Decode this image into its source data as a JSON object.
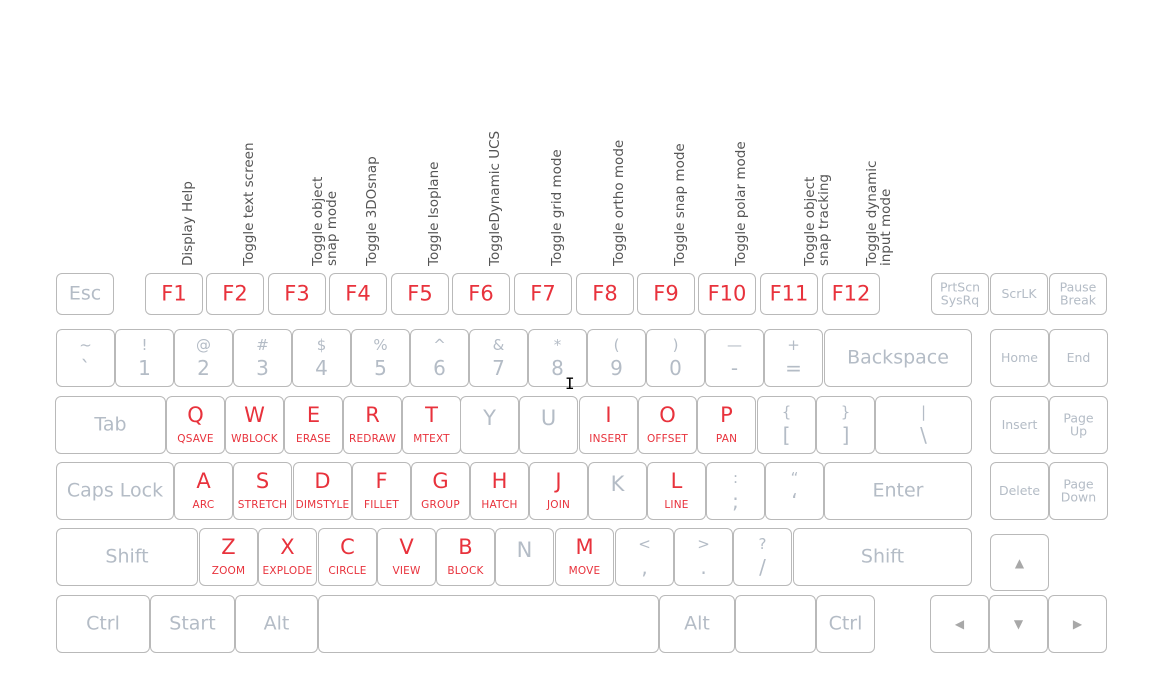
{
  "function_descriptions": [
    {
      "key": "F1",
      "lines": [
        "Display Help"
      ]
    },
    {
      "key": "F2",
      "lines": [
        "Toggle text screen"
      ]
    },
    {
      "key": "F3",
      "lines": [
        "Toggle object",
        "snap mode"
      ]
    },
    {
      "key": "F4",
      "lines": [
        "Toggle 3DOsnap"
      ]
    },
    {
      "key": "F5",
      "lines": [
        "Toggle Isoplane"
      ]
    },
    {
      "key": "F6",
      "lines": [
        "ToggleDynamic UCS"
      ]
    },
    {
      "key": "F7",
      "lines": [
        "Toggle grid mode"
      ]
    },
    {
      "key": "F8",
      "lines": [
        "Toggle ortho mode"
      ]
    },
    {
      "key": "F9",
      "lines": [
        "Toggle snap mode"
      ]
    },
    {
      "key": "F10",
      "lines": [
        "Toggle polar mode"
      ]
    },
    {
      "key": "F11",
      "lines": [
        "Toggle object",
        "snap tracking"
      ]
    },
    {
      "key": "F12",
      "lines": [
        "Toggle dynamic",
        "input mode"
      ]
    }
  ],
  "colors": {
    "accent": "#e8323c",
    "key_text": "#b4bcc6",
    "border": "#b9b9b9",
    "description_text": "#555555"
  },
  "keys": {
    "esc": "Esc",
    "fkeys": [
      "F1",
      "F2",
      "F3",
      "F4",
      "F5",
      "F6",
      "F7",
      "F8",
      "F9",
      "F10",
      "F11",
      "F12"
    ],
    "prtscn": [
      "PrtScn",
      "SysRq"
    ],
    "scrlk": "ScrLK",
    "pause": [
      "Pause",
      "Break"
    ],
    "number_row": [
      {
        "top": "~",
        "bot": "`"
      },
      {
        "top": "!",
        "bot": "1"
      },
      {
        "top": "@",
        "bot": "2"
      },
      {
        "top": "#",
        "bot": "3"
      },
      {
        "top": "$",
        "bot": "4"
      },
      {
        "top": "%",
        "bot": "5"
      },
      {
        "top": "^",
        "bot": "6"
      },
      {
        "top": "&",
        "bot": "7"
      },
      {
        "top": "*",
        "bot": "8"
      },
      {
        "top": "(",
        "bot": "9"
      },
      {
        "top": ")",
        "bot": "0"
      },
      {
        "top": "—",
        "bot": "-"
      },
      {
        "top": "+",
        "bot": "="
      }
    ],
    "backspace": "Backspace",
    "home": "Home",
    "end": "End",
    "tab": "Tab",
    "qwerty_row": [
      {
        "key": "Q",
        "cmd": "QSAVE"
      },
      {
        "key": "W",
        "cmd": "WBLOCK"
      },
      {
        "key": "E",
        "cmd": "ERASE"
      },
      {
        "key": "R",
        "cmd": "REDRAW"
      },
      {
        "key": "T",
        "cmd": "MTEXT"
      },
      {
        "key": "Y",
        "cmd": ""
      },
      {
        "key": "U",
        "cmd": ""
      },
      {
        "key": "I",
        "cmd": "INSERT"
      },
      {
        "key": "O",
        "cmd": "OFFSET"
      },
      {
        "key": "P",
        "cmd": "PAN"
      }
    ],
    "brackets": [
      {
        "top": "{",
        "bot": "["
      },
      {
        "top": "}",
        "bot": "]"
      },
      {
        "top": "|",
        "bot": "\\"
      }
    ],
    "insert": "Insert",
    "pageup": [
      "Page",
      "Up"
    ],
    "capslock": "Caps Lock",
    "home_row": [
      {
        "key": "A",
        "cmd": "ARC"
      },
      {
        "key": "S",
        "cmd": "STRETCH"
      },
      {
        "key": "D",
        "cmd": "DIMSTYLE"
      },
      {
        "key": "F",
        "cmd": "FILLET"
      },
      {
        "key": "G",
        "cmd": "GROUP"
      },
      {
        "key": "H",
        "cmd": "HATCH"
      },
      {
        "key": "J",
        "cmd": "JOIN"
      },
      {
        "key": "K",
        "cmd": ""
      },
      {
        "key": "L",
        "cmd": "LINE"
      }
    ],
    "semi": [
      {
        "top": ":",
        "bot": ";"
      },
      {
        "top": "“",
        "bot": "‘"
      }
    ],
    "enter": "Enter",
    "delete": "Delete",
    "pagedown": [
      "Page",
      "Down"
    ],
    "shift": "Shift",
    "bottom_alpha": [
      {
        "key": "Z",
        "cmd": "ZOOM"
      },
      {
        "key": "X",
        "cmd": "EXPLODE"
      },
      {
        "key": "C",
        "cmd": "CIRCLE"
      },
      {
        "key": "V",
        "cmd": "VIEW"
      },
      {
        "key": "B",
        "cmd": "BLOCK"
      },
      {
        "key": "N",
        "cmd": ""
      },
      {
        "key": "M",
        "cmd": "MOVE"
      }
    ],
    "punct": [
      {
        "top": "<",
        "bot": ","
      },
      {
        "top": ">",
        "bot": "."
      },
      {
        "top": "?",
        "bot": "/"
      }
    ],
    "ctrl": "Ctrl",
    "start": "Start",
    "alt": "Alt",
    "arrows": {
      "up": "▲",
      "left": "◀",
      "down": "▼",
      "right": "▶"
    }
  }
}
